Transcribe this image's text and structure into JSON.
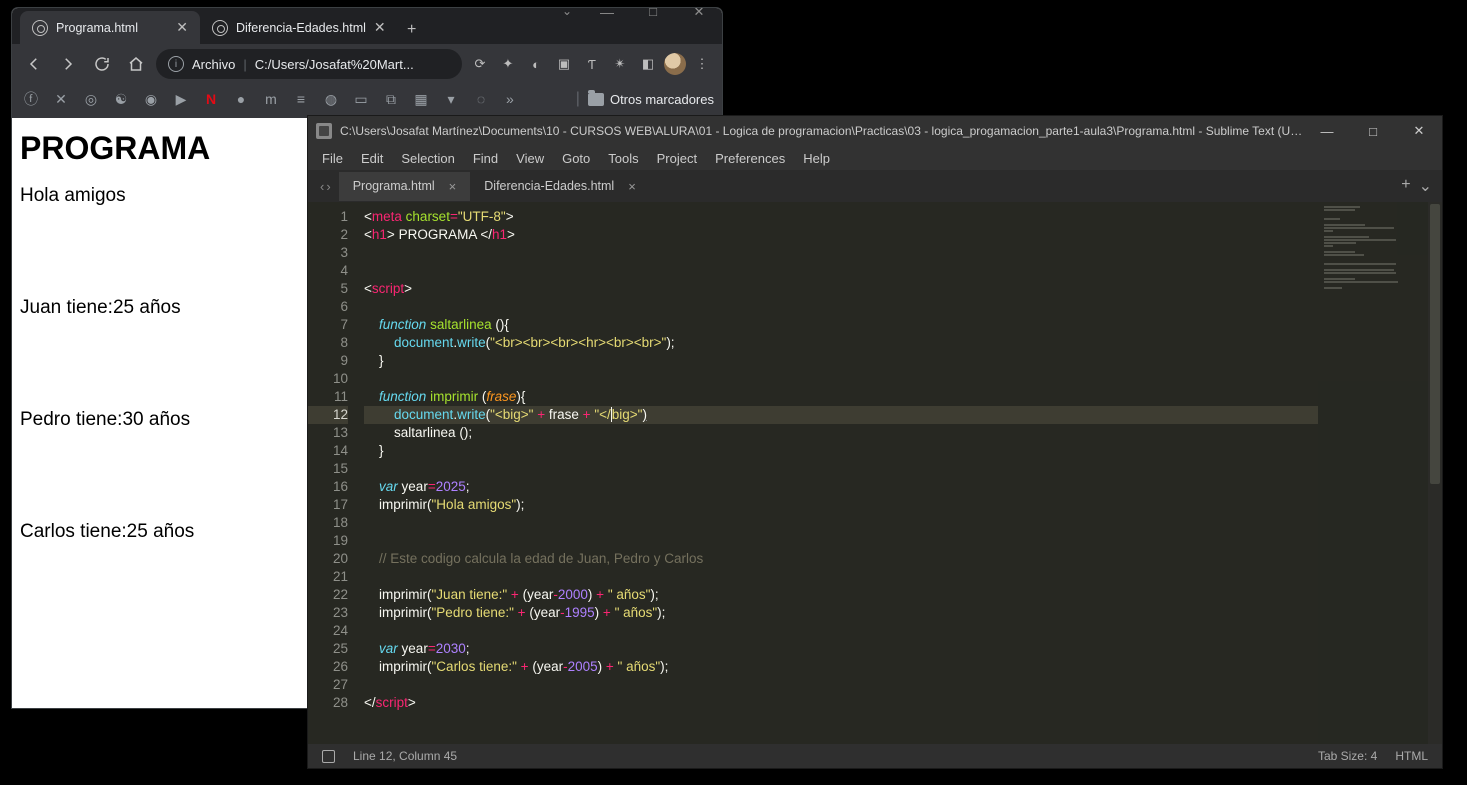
{
  "browser": {
    "tabs": [
      {
        "title": "Programa.html",
        "active": true
      },
      {
        "title": "Diferencia-Edades.html",
        "active": false
      }
    ],
    "wincontrols": {
      "min": "—",
      "max": "□",
      "close": "✕"
    },
    "omnibox": {
      "scheme_label": "Archivo",
      "url": "C:/Users/Josafat%20Mart..."
    },
    "bookmark_folder": "Otros marcadores",
    "overflow": "»"
  },
  "page": {
    "h1": "PROGRAMA",
    "lines": [
      "Hola amigos",
      "Juan tiene:25 años",
      "Pedro tiene:30 años",
      "Carlos tiene:25 años"
    ]
  },
  "sublime": {
    "title": "C:\\Users\\Josafat Martínez\\Documents\\10 - CURSOS WEB\\ALURA\\01 - Logica de programacion\\Practicas\\03 - logica_progamacion_parte1-aula3\\Programa.html - Sublime Text (UNREG...",
    "wincontrols": {
      "min": "—",
      "max": "□",
      "close": "✕"
    },
    "menus": [
      "File",
      "Edit",
      "Selection",
      "Find",
      "View",
      "Goto",
      "Tools",
      "Project",
      "Preferences",
      "Help"
    ],
    "tabs": [
      {
        "title": "Programa.html",
        "active": true
      },
      {
        "title": "Diferencia-Edades.html",
        "active": false
      }
    ],
    "tabbar_nav": {
      "back": "‹",
      "fwd": "›"
    },
    "tabbar_right": {
      "add": "+",
      "menu": "⌄"
    },
    "line_count": 28,
    "highlight_line": 12,
    "status": {
      "pos": "Line 12, Column 45",
      "tabsize": "Tab Size: 4",
      "lang": "HTML"
    },
    "code": {
      "l1": {
        "meta": "meta",
        "charset": "charset",
        "eq": "=",
        "val": "\"UTF-8\""
      },
      "l2": {
        "h1o": "h1",
        "txt": " PROGRAMA ",
        "h1c": "h1"
      },
      "l5": {
        "script": "script"
      },
      "l7": {
        "fn_kw": "function",
        "name": "saltarlinea"
      },
      "l8": {
        "obj": "document",
        "m": "write",
        "arg": "\"<br><br><br><hr><br><br>\""
      },
      "l11": {
        "fn_kw": "function",
        "name": "imprimir",
        "param": "frase"
      },
      "l12": {
        "obj": "document",
        "m": "write",
        "a1": "\"<big>\"",
        "plus": "+",
        "v": "frase",
        "a2": "\"</big>\""
      },
      "l13": {
        "call": "saltarlinea"
      },
      "l16": {
        "var": "var",
        "name": "year",
        "eq": "=",
        "val": "2025"
      },
      "l17": {
        "call": "imprimir",
        "arg": "\"Hola amigos\""
      },
      "l20": {
        "cmt": "// Este codigo calcula la edad de Juan, Pedro y Carlos"
      },
      "l22": {
        "call": "imprimir",
        "a1": "\"Juan tiene:\"",
        "v": "year",
        "n": "2000",
        "a2": "\" años\""
      },
      "l23": {
        "call": "imprimir",
        "a1": "\"Pedro tiene:\"",
        "v": "year",
        "n": "1995",
        "a2": "\" años\""
      },
      "l25": {
        "var": "var",
        "name": "year",
        "eq": "=",
        "val": "2030"
      },
      "l26": {
        "call": "imprimir",
        "a1": "\"Carlos tiene:\"",
        "v": "year",
        "n": "2005",
        "a2": "\" años\""
      },
      "l28": {
        "script": "script"
      }
    }
  }
}
